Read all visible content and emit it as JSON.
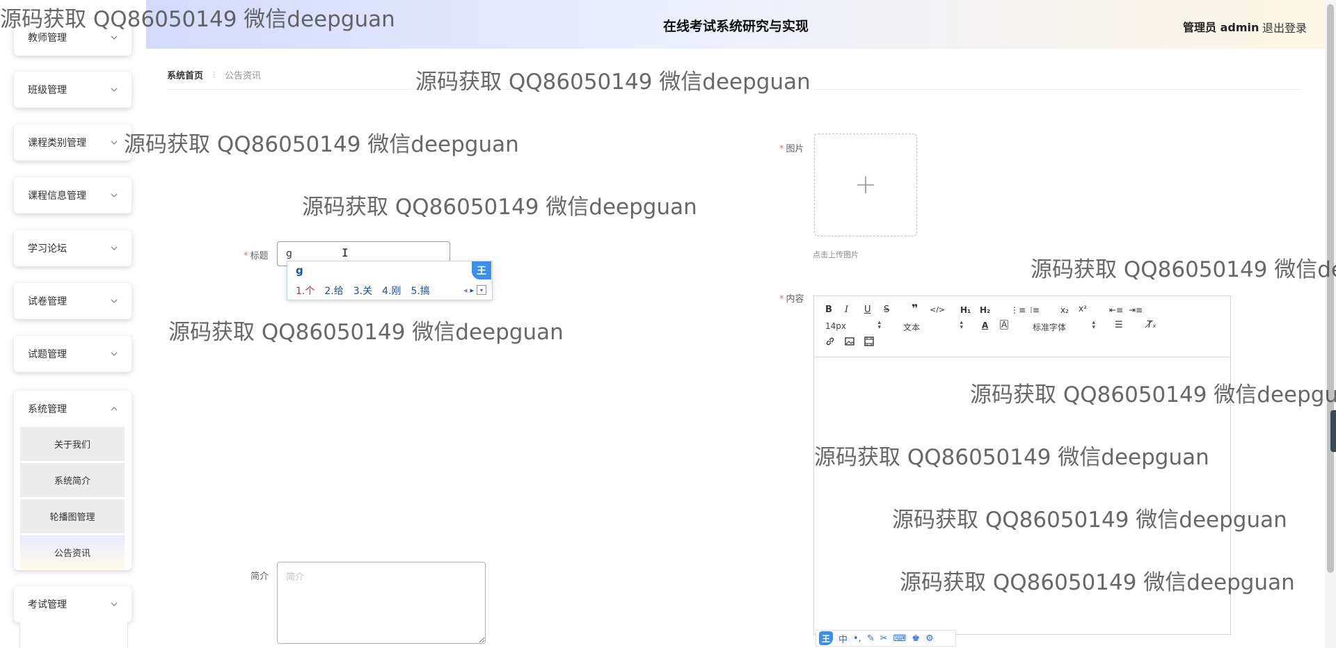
{
  "header": {
    "title": "在线考试系统研究与实现",
    "user": "管理员 admin",
    "logout": "退出登录"
  },
  "breadcrumb": {
    "home": "系统首页",
    "current": "公告资讯"
  },
  "sidebar": {
    "items": [
      "教师管理",
      "班级管理",
      "课程类别管理",
      "课程信息管理",
      "学习论坛",
      "试卷管理",
      "试题管理",
      "系统管理",
      "考试管理"
    ],
    "system_sub": [
      "关于我们",
      "系统简介",
      "轮播图管理",
      "公告资讯"
    ]
  },
  "form": {
    "title_label": "标题",
    "title_value": "g",
    "image_label": "图片",
    "upload_hint": "点击上传图片",
    "content_label": "内容",
    "intro_label": "简介",
    "intro_placeholder": "简介"
  },
  "ime": {
    "composition": "g",
    "candidates": [
      "1.个",
      "2.给",
      "3.关",
      "4.刚",
      "5.搞"
    ],
    "logo": "王",
    "bar_text": "中"
  },
  "editor": {
    "font_size": "14px",
    "block_type": "文本",
    "font_family": "标准字体"
  },
  "watermark": "源码获取 QQ86050149 微信deepguan",
  "watermark_cut": "源码获取 QQ86050149 微信deepguar",
  "watermark_cut2": "源码获取 QQ86050149 微信dee",
  "colors": {
    "required": "#f56c6c",
    "header_from": "#d3dbfb",
    "header_to": "#fdf6e6"
  }
}
